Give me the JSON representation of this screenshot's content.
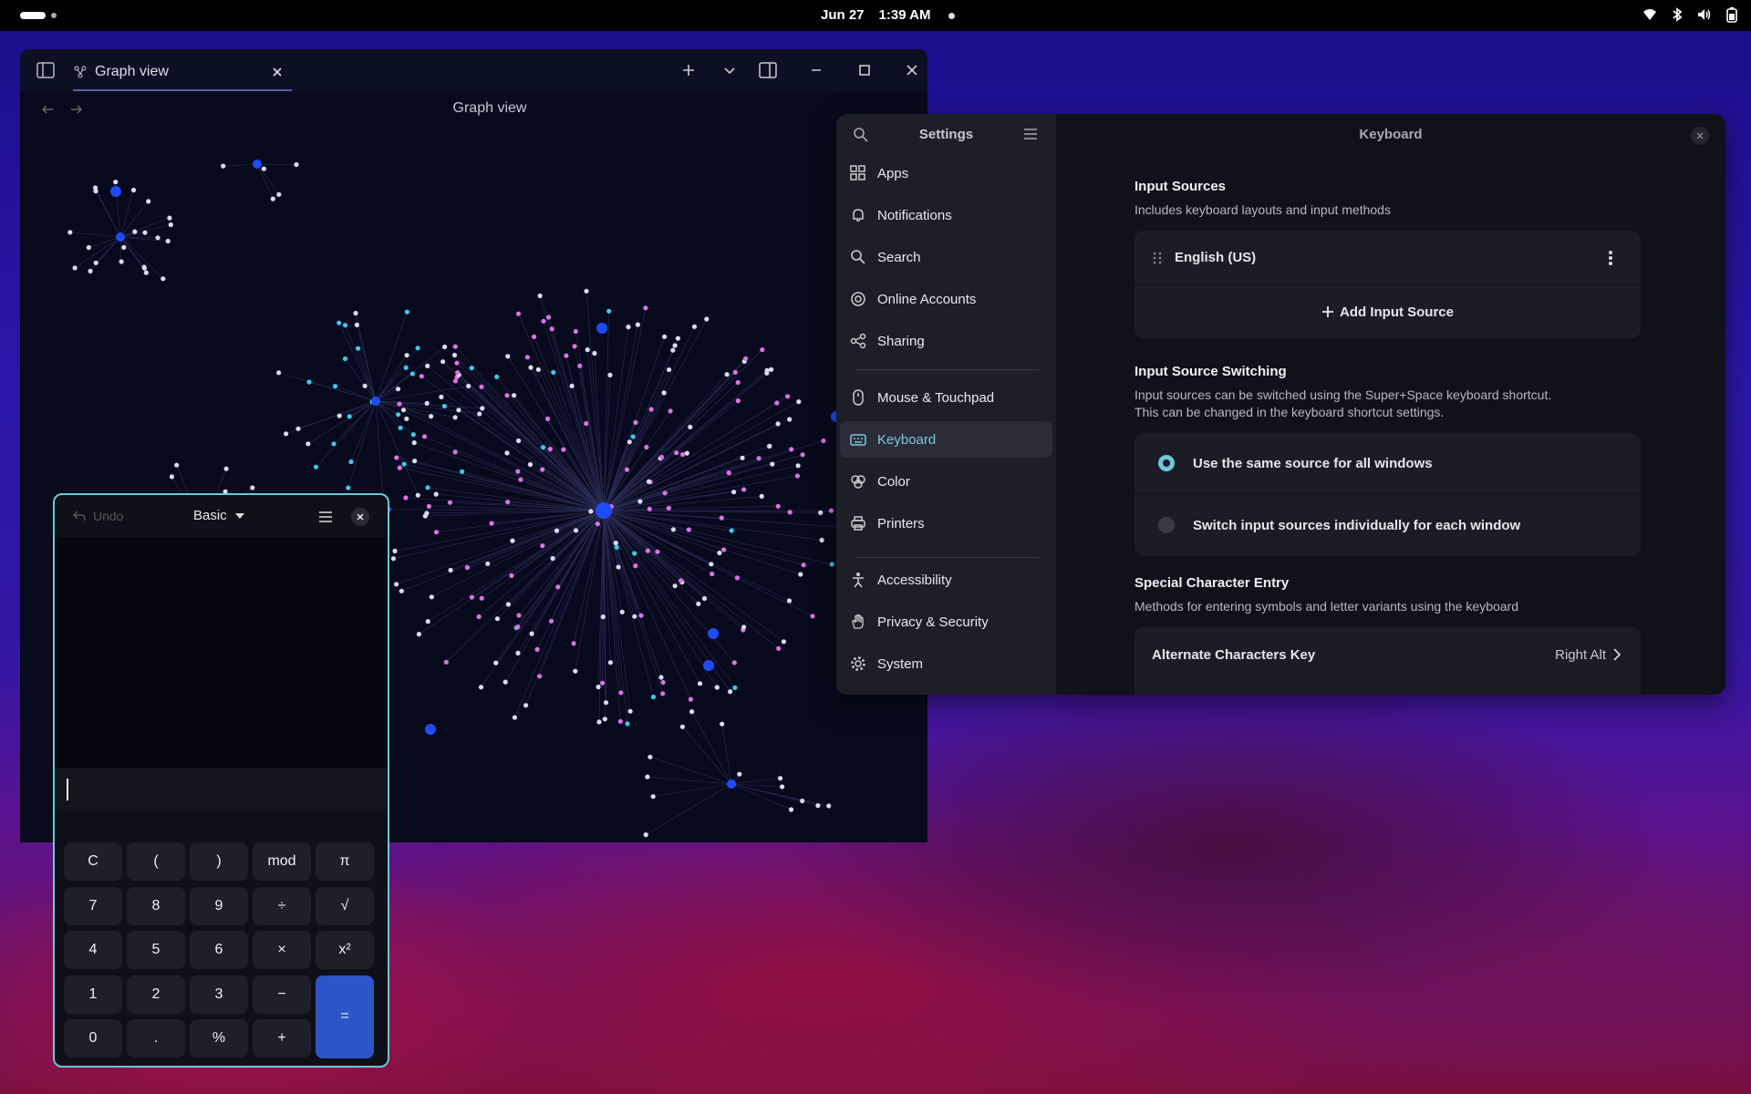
{
  "topbar": {
    "date": "Jun 27",
    "time": "1:39 AM",
    "tray_icons": [
      "wifi-icon",
      "bluetooth-icon",
      "volume-icon",
      "battery-icon"
    ]
  },
  "obsidian": {
    "tab_label": "Graph view",
    "view_title": "Graph view"
  },
  "settings": {
    "sidebar_title": "Settings",
    "items": [
      {
        "label": "Apps",
        "icon": "apps-icon"
      },
      {
        "label": "Notifications",
        "icon": "bell-icon"
      },
      {
        "label": "Search",
        "icon": "search-icon"
      },
      {
        "label": "Online Accounts",
        "icon": "at-icon"
      },
      {
        "label": "Sharing",
        "icon": "share-icon"
      },
      {
        "label": "Mouse & Touchpad",
        "icon": "mouse-icon"
      },
      {
        "label": "Keyboard",
        "icon": "keyboard-icon"
      },
      {
        "label": "Color",
        "icon": "color-icon"
      },
      {
        "label": "Printers",
        "icon": "printer-icon"
      },
      {
        "label": "Accessibility",
        "icon": "accessibility-icon"
      },
      {
        "label": "Privacy & Security",
        "icon": "hand-icon"
      },
      {
        "label": "System",
        "icon": "gear-icon"
      }
    ],
    "page_title": "Keyboard",
    "input_sources": {
      "heading": "Input Sources",
      "description": "Includes keyboard layouts and input methods",
      "source": "English (US)",
      "add_label": "Add Input Source"
    },
    "switching": {
      "heading": "Input Source Switching",
      "description_line1": "Input sources can be switched using the Super+Space keyboard shortcut.",
      "description_line2": "This can be changed in the keyboard shortcut settings.",
      "option_same": "Use the same source for all windows",
      "option_individual": "Switch input sources individually for each window",
      "selected": "option_same"
    },
    "special_chars": {
      "heading": "Special Character Entry",
      "description": "Methods for entering symbols and letter variants using the keyboard",
      "alt_key_label": "Alternate Characters Key",
      "alt_key_value": "Right Alt"
    }
  },
  "calculator": {
    "undo_label": "Undo",
    "mode_label": "Basic",
    "keys": [
      [
        "C",
        "(",
        ")",
        "mod",
        "π"
      ],
      [
        "7",
        "8",
        "9",
        "÷",
        "√"
      ],
      [
        "4",
        "5",
        "6",
        "×",
        "x²"
      ],
      [
        "1",
        "2",
        "3",
        "−",
        "="
      ],
      [
        "0",
        ".",
        "%",
        "+",
        ""
      ]
    ],
    "accent": "#2d55c8"
  },
  "colors": {
    "accent_teal": "#6fc6d8",
    "graph_node_blue": "#1f4bff",
    "graph_node_pink": "#e070e8",
    "graph_node_cyan": "#3cc8f0",
    "graph_node_white": "#d8dcf0"
  }
}
